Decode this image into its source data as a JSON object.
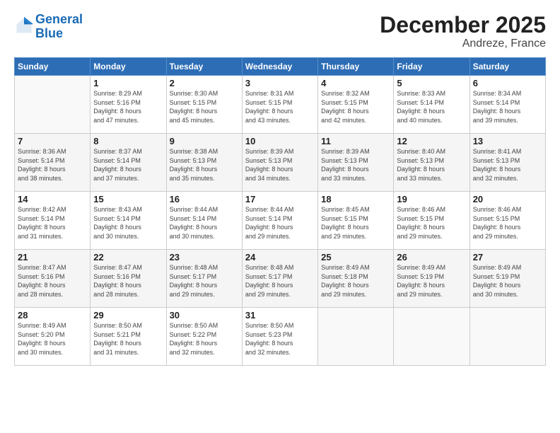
{
  "logo": {
    "line1": "General",
    "line2": "Blue"
  },
  "title": "December 2025",
  "subtitle": "Andreze, France",
  "days_of_week": [
    "Sunday",
    "Monday",
    "Tuesday",
    "Wednesday",
    "Thursday",
    "Friday",
    "Saturday"
  ],
  "weeks": [
    [
      {
        "day": "",
        "info": ""
      },
      {
        "day": "1",
        "info": "Sunrise: 8:29 AM\nSunset: 5:16 PM\nDaylight: 8 hours\nand 47 minutes."
      },
      {
        "day": "2",
        "info": "Sunrise: 8:30 AM\nSunset: 5:15 PM\nDaylight: 8 hours\nand 45 minutes."
      },
      {
        "day": "3",
        "info": "Sunrise: 8:31 AM\nSunset: 5:15 PM\nDaylight: 8 hours\nand 43 minutes."
      },
      {
        "day": "4",
        "info": "Sunrise: 8:32 AM\nSunset: 5:15 PM\nDaylight: 8 hours\nand 42 minutes."
      },
      {
        "day": "5",
        "info": "Sunrise: 8:33 AM\nSunset: 5:14 PM\nDaylight: 8 hours\nand 40 minutes."
      },
      {
        "day": "6",
        "info": "Sunrise: 8:34 AM\nSunset: 5:14 PM\nDaylight: 8 hours\nand 39 minutes."
      }
    ],
    [
      {
        "day": "7",
        "info": "Sunrise: 8:36 AM\nSunset: 5:14 PM\nDaylight: 8 hours\nand 38 minutes."
      },
      {
        "day": "8",
        "info": "Sunrise: 8:37 AM\nSunset: 5:14 PM\nDaylight: 8 hours\nand 37 minutes."
      },
      {
        "day": "9",
        "info": "Sunrise: 8:38 AM\nSunset: 5:13 PM\nDaylight: 8 hours\nand 35 minutes."
      },
      {
        "day": "10",
        "info": "Sunrise: 8:39 AM\nSunset: 5:13 PM\nDaylight: 8 hours\nand 34 minutes."
      },
      {
        "day": "11",
        "info": "Sunrise: 8:39 AM\nSunset: 5:13 PM\nDaylight: 8 hours\nand 33 minutes."
      },
      {
        "day": "12",
        "info": "Sunrise: 8:40 AM\nSunset: 5:13 PM\nDaylight: 8 hours\nand 33 minutes."
      },
      {
        "day": "13",
        "info": "Sunrise: 8:41 AM\nSunset: 5:13 PM\nDaylight: 8 hours\nand 32 minutes."
      }
    ],
    [
      {
        "day": "14",
        "info": "Sunrise: 8:42 AM\nSunset: 5:14 PM\nDaylight: 8 hours\nand 31 minutes."
      },
      {
        "day": "15",
        "info": "Sunrise: 8:43 AM\nSunset: 5:14 PM\nDaylight: 8 hours\nand 30 minutes."
      },
      {
        "day": "16",
        "info": "Sunrise: 8:44 AM\nSunset: 5:14 PM\nDaylight: 8 hours\nand 30 minutes."
      },
      {
        "day": "17",
        "info": "Sunrise: 8:44 AM\nSunset: 5:14 PM\nDaylight: 8 hours\nand 29 minutes."
      },
      {
        "day": "18",
        "info": "Sunrise: 8:45 AM\nSunset: 5:15 PM\nDaylight: 8 hours\nand 29 minutes."
      },
      {
        "day": "19",
        "info": "Sunrise: 8:46 AM\nSunset: 5:15 PM\nDaylight: 8 hours\nand 29 minutes."
      },
      {
        "day": "20",
        "info": "Sunrise: 8:46 AM\nSunset: 5:15 PM\nDaylight: 8 hours\nand 29 minutes."
      }
    ],
    [
      {
        "day": "21",
        "info": "Sunrise: 8:47 AM\nSunset: 5:16 PM\nDaylight: 8 hours\nand 28 minutes."
      },
      {
        "day": "22",
        "info": "Sunrise: 8:47 AM\nSunset: 5:16 PM\nDaylight: 8 hours\nand 28 minutes."
      },
      {
        "day": "23",
        "info": "Sunrise: 8:48 AM\nSunset: 5:17 PM\nDaylight: 8 hours\nand 29 minutes."
      },
      {
        "day": "24",
        "info": "Sunrise: 8:48 AM\nSunset: 5:17 PM\nDaylight: 8 hours\nand 29 minutes."
      },
      {
        "day": "25",
        "info": "Sunrise: 8:49 AM\nSunset: 5:18 PM\nDaylight: 8 hours\nand 29 minutes."
      },
      {
        "day": "26",
        "info": "Sunrise: 8:49 AM\nSunset: 5:19 PM\nDaylight: 8 hours\nand 29 minutes."
      },
      {
        "day": "27",
        "info": "Sunrise: 8:49 AM\nSunset: 5:19 PM\nDaylight: 8 hours\nand 30 minutes."
      }
    ],
    [
      {
        "day": "28",
        "info": "Sunrise: 8:49 AM\nSunset: 5:20 PM\nDaylight: 8 hours\nand 30 minutes."
      },
      {
        "day": "29",
        "info": "Sunrise: 8:50 AM\nSunset: 5:21 PM\nDaylight: 8 hours\nand 31 minutes."
      },
      {
        "day": "30",
        "info": "Sunrise: 8:50 AM\nSunset: 5:22 PM\nDaylight: 8 hours\nand 32 minutes."
      },
      {
        "day": "31",
        "info": "Sunrise: 8:50 AM\nSunset: 5:23 PM\nDaylight: 8 hours\nand 32 minutes."
      },
      {
        "day": "",
        "info": ""
      },
      {
        "day": "",
        "info": ""
      },
      {
        "day": "",
        "info": ""
      }
    ]
  ]
}
